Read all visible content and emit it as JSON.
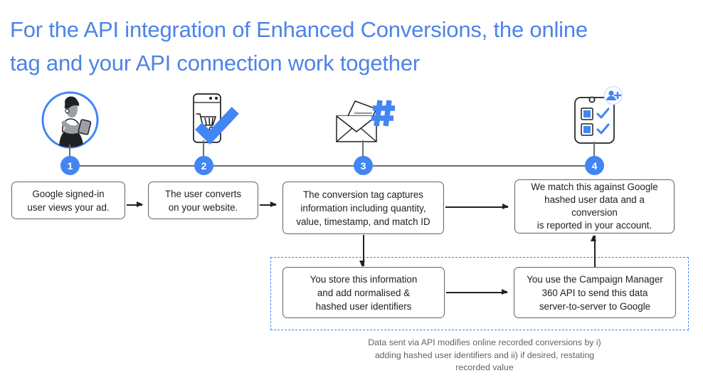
{
  "title": "For the API integration of Enhanced Conversions, the online\ntag and your API connection work together",
  "title_color": "#4D83E8",
  "accent_color": "#4285F4",
  "timeline": {
    "steps": [
      {
        "number": "1",
        "icon": "person-with-tablet-icon"
      },
      {
        "number": "2",
        "icon": "mobile-cart-check-icon"
      },
      {
        "number": "3",
        "icon": "envelope-hash-icon"
      },
      {
        "number": "4",
        "icon": "clipboard-checklist-user-icon"
      }
    ]
  },
  "boxes": {
    "step1": "Google signed-in\nuser views your ad.",
    "step2": "The user converts\non your website.",
    "step3": "The conversion tag captures\ninformation including quantity,\nvalue, timestamp, and match ID",
    "step4": "We match this against Google\nhashed user data and a\nconversion\nis reported in your account.",
    "step5": "You store this information\nand add normalised &\nhashed user identifiers",
    "step6": "You use the Campaign Manager\n360 API to send this data\nserver-to-server to Google"
  },
  "caption": "Data sent via API modifies online recorded conversions by i)\nadding hashed user identifiers and ii) if desired, restating\nrecorded value"
}
